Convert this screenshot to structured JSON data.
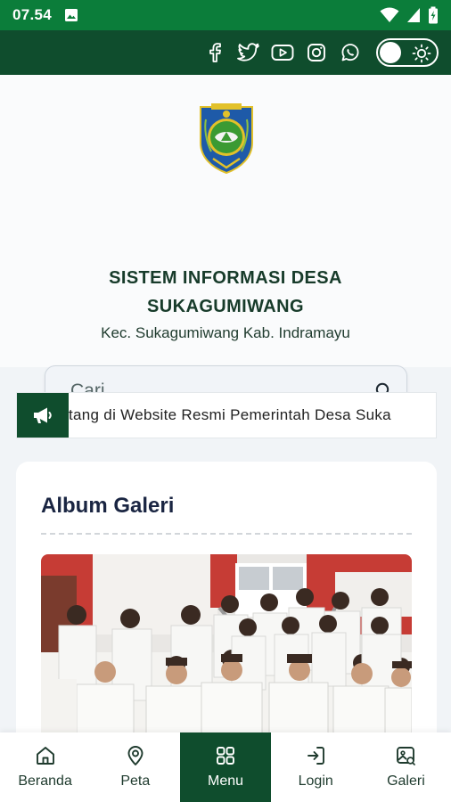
{
  "status_bar": {
    "time": "07.54",
    "icons": [
      "gallery-notification-icon",
      "wifi-icon",
      "signal-icon",
      "battery-icon"
    ]
  },
  "topbar": {
    "social_icons": [
      "facebook-icon",
      "twitter-icon",
      "youtube-icon",
      "instagram-icon",
      "whatsapp-icon"
    ],
    "theme_toggle": "sun-icon"
  },
  "hero": {
    "title_line1": "SISTEM INFORMASI DESA",
    "title_line2": "SUKAGUMIWANG",
    "subtitle": "Kec. Sukagumiwang Kab. Indramayu",
    "search_placeholder": "Cari..."
  },
  "ticker": {
    "text": "tang di Website Resmi Pemerintah Desa Suka"
  },
  "gallery": {
    "title": "Album Galeri"
  },
  "bottom_nav": {
    "items": [
      {
        "label": "Beranda",
        "icon": "home-icon"
      },
      {
        "label": "Peta",
        "icon": "map-pin-icon"
      },
      {
        "label": "Menu",
        "icon": "grid-icon"
      },
      {
        "label": "Login",
        "icon": "login-icon"
      },
      {
        "label": "Galeri",
        "icon": "gallery-icon"
      }
    ],
    "active": "Menu"
  },
  "colors": {
    "status_bar": "#0b7d3a",
    "header": "#0f4d2d",
    "title_text": "#173b2a",
    "card_title": "#1a2542"
  }
}
